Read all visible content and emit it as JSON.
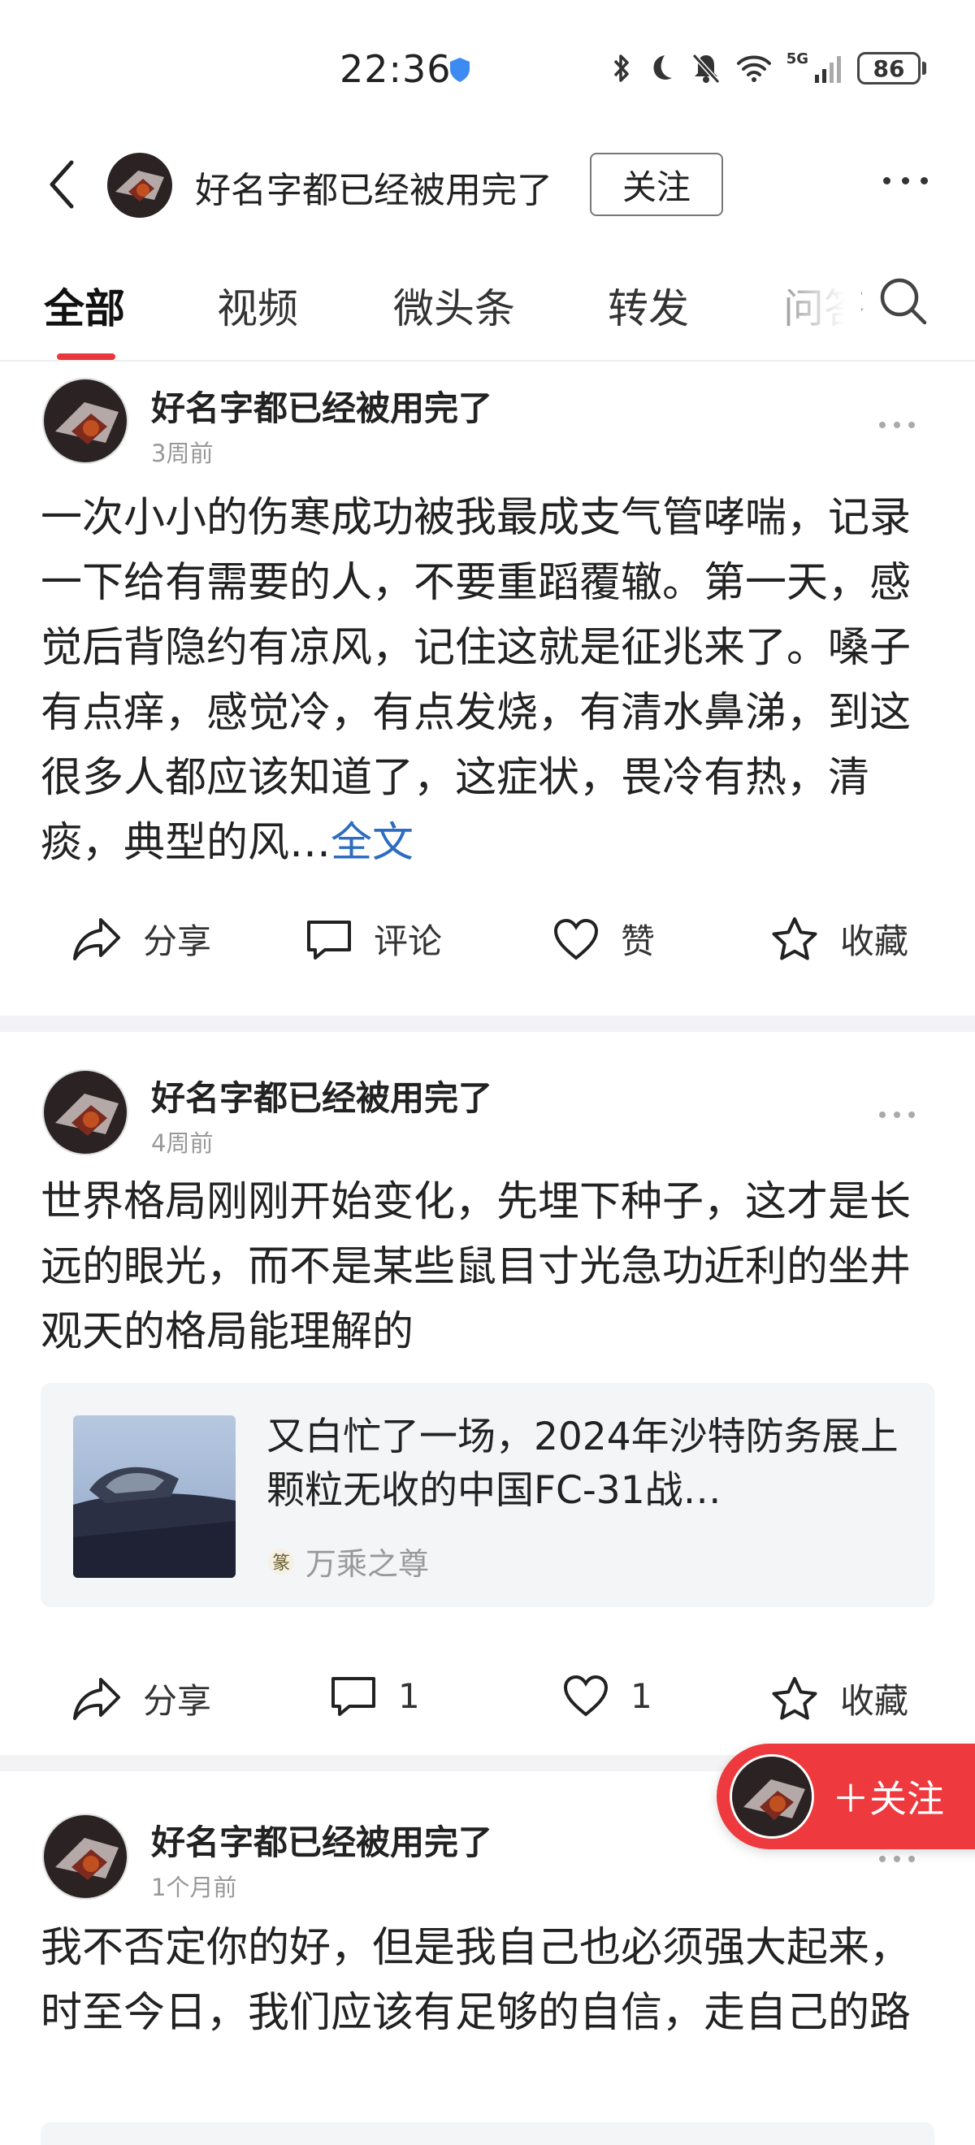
{
  "status_bar": {
    "time": "22:36",
    "network_label": "5G",
    "battery_level": "86"
  },
  "header": {
    "name": "好名字都已经被用完了",
    "follow_label": "关注"
  },
  "tabs": [
    "全部",
    "视频",
    "微头条",
    "转发",
    "问答"
  ],
  "active_tab": 0,
  "posts": [
    {
      "author": "好名字都已经被用完了",
      "time": "3周前",
      "text": "一次小小的伤寒成功被我最成支气管哮喘，记录一下给有需要的人，不要重蹈覆辙。第一天，感觉后背隐约有凉风，记住这就是征兆来了。嗓子有点痒，感觉冷，有点发烧，有清水鼻涕，到这很多人都应该知道了，这症状，畏冷有热，清痰，典型的风…",
      "full_text_label": "全文",
      "actions": {
        "share": "分享",
        "comment": "评论",
        "like": "赞",
        "collect": "收藏"
      }
    },
    {
      "author": "好名字都已经被用完了",
      "time": "4周前",
      "text": "世界格局刚刚开始变化，先埋下种子，这才是长远的眼光，而不是某些鼠目寸光急功近利的坐井观天的格局能理解的",
      "card": {
        "title": "又白忙了一场，2024年沙特防务展上颗粒无收的中国FC-31战…",
        "source": "万乘之尊"
      },
      "actions": {
        "share": "分享",
        "comment": "1",
        "like": "1",
        "collect": "收藏"
      }
    },
    {
      "author": "好名字都已经被用完了",
      "time": "1个月前",
      "text": "我不否定你的好，但是我自己也必须强大起来，时至今日，我们应该有足够的自信，走自己的路"
    }
  ],
  "floating_follow": {
    "label": "＋关注"
  },
  "colors": {
    "accent": "#e8383d",
    "link": "#2d6cc1",
    "float_button": "#ee3a3f"
  }
}
